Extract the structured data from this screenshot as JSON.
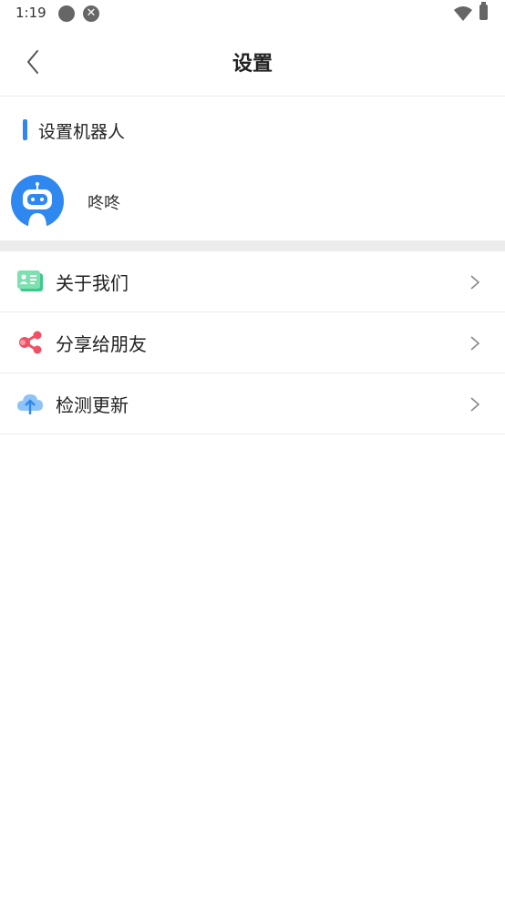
{
  "status_bar": {
    "time": "1:19"
  },
  "header": {
    "title": "设置"
  },
  "robot_section": {
    "title": "设置机器人",
    "robot_name": "咚咚"
  },
  "menu": {
    "items": [
      {
        "label": "关于我们",
        "icon": "about-us-icon",
        "color": "#3cc98a"
      },
      {
        "label": "分享给朋友",
        "icon": "share-icon",
        "color": "#f05064"
      },
      {
        "label": "检测更新",
        "icon": "cloud-upload-icon",
        "color": "#5aa5f2"
      }
    ]
  },
  "colors": {
    "accent": "#2f88f0",
    "divider": "#ececec"
  }
}
